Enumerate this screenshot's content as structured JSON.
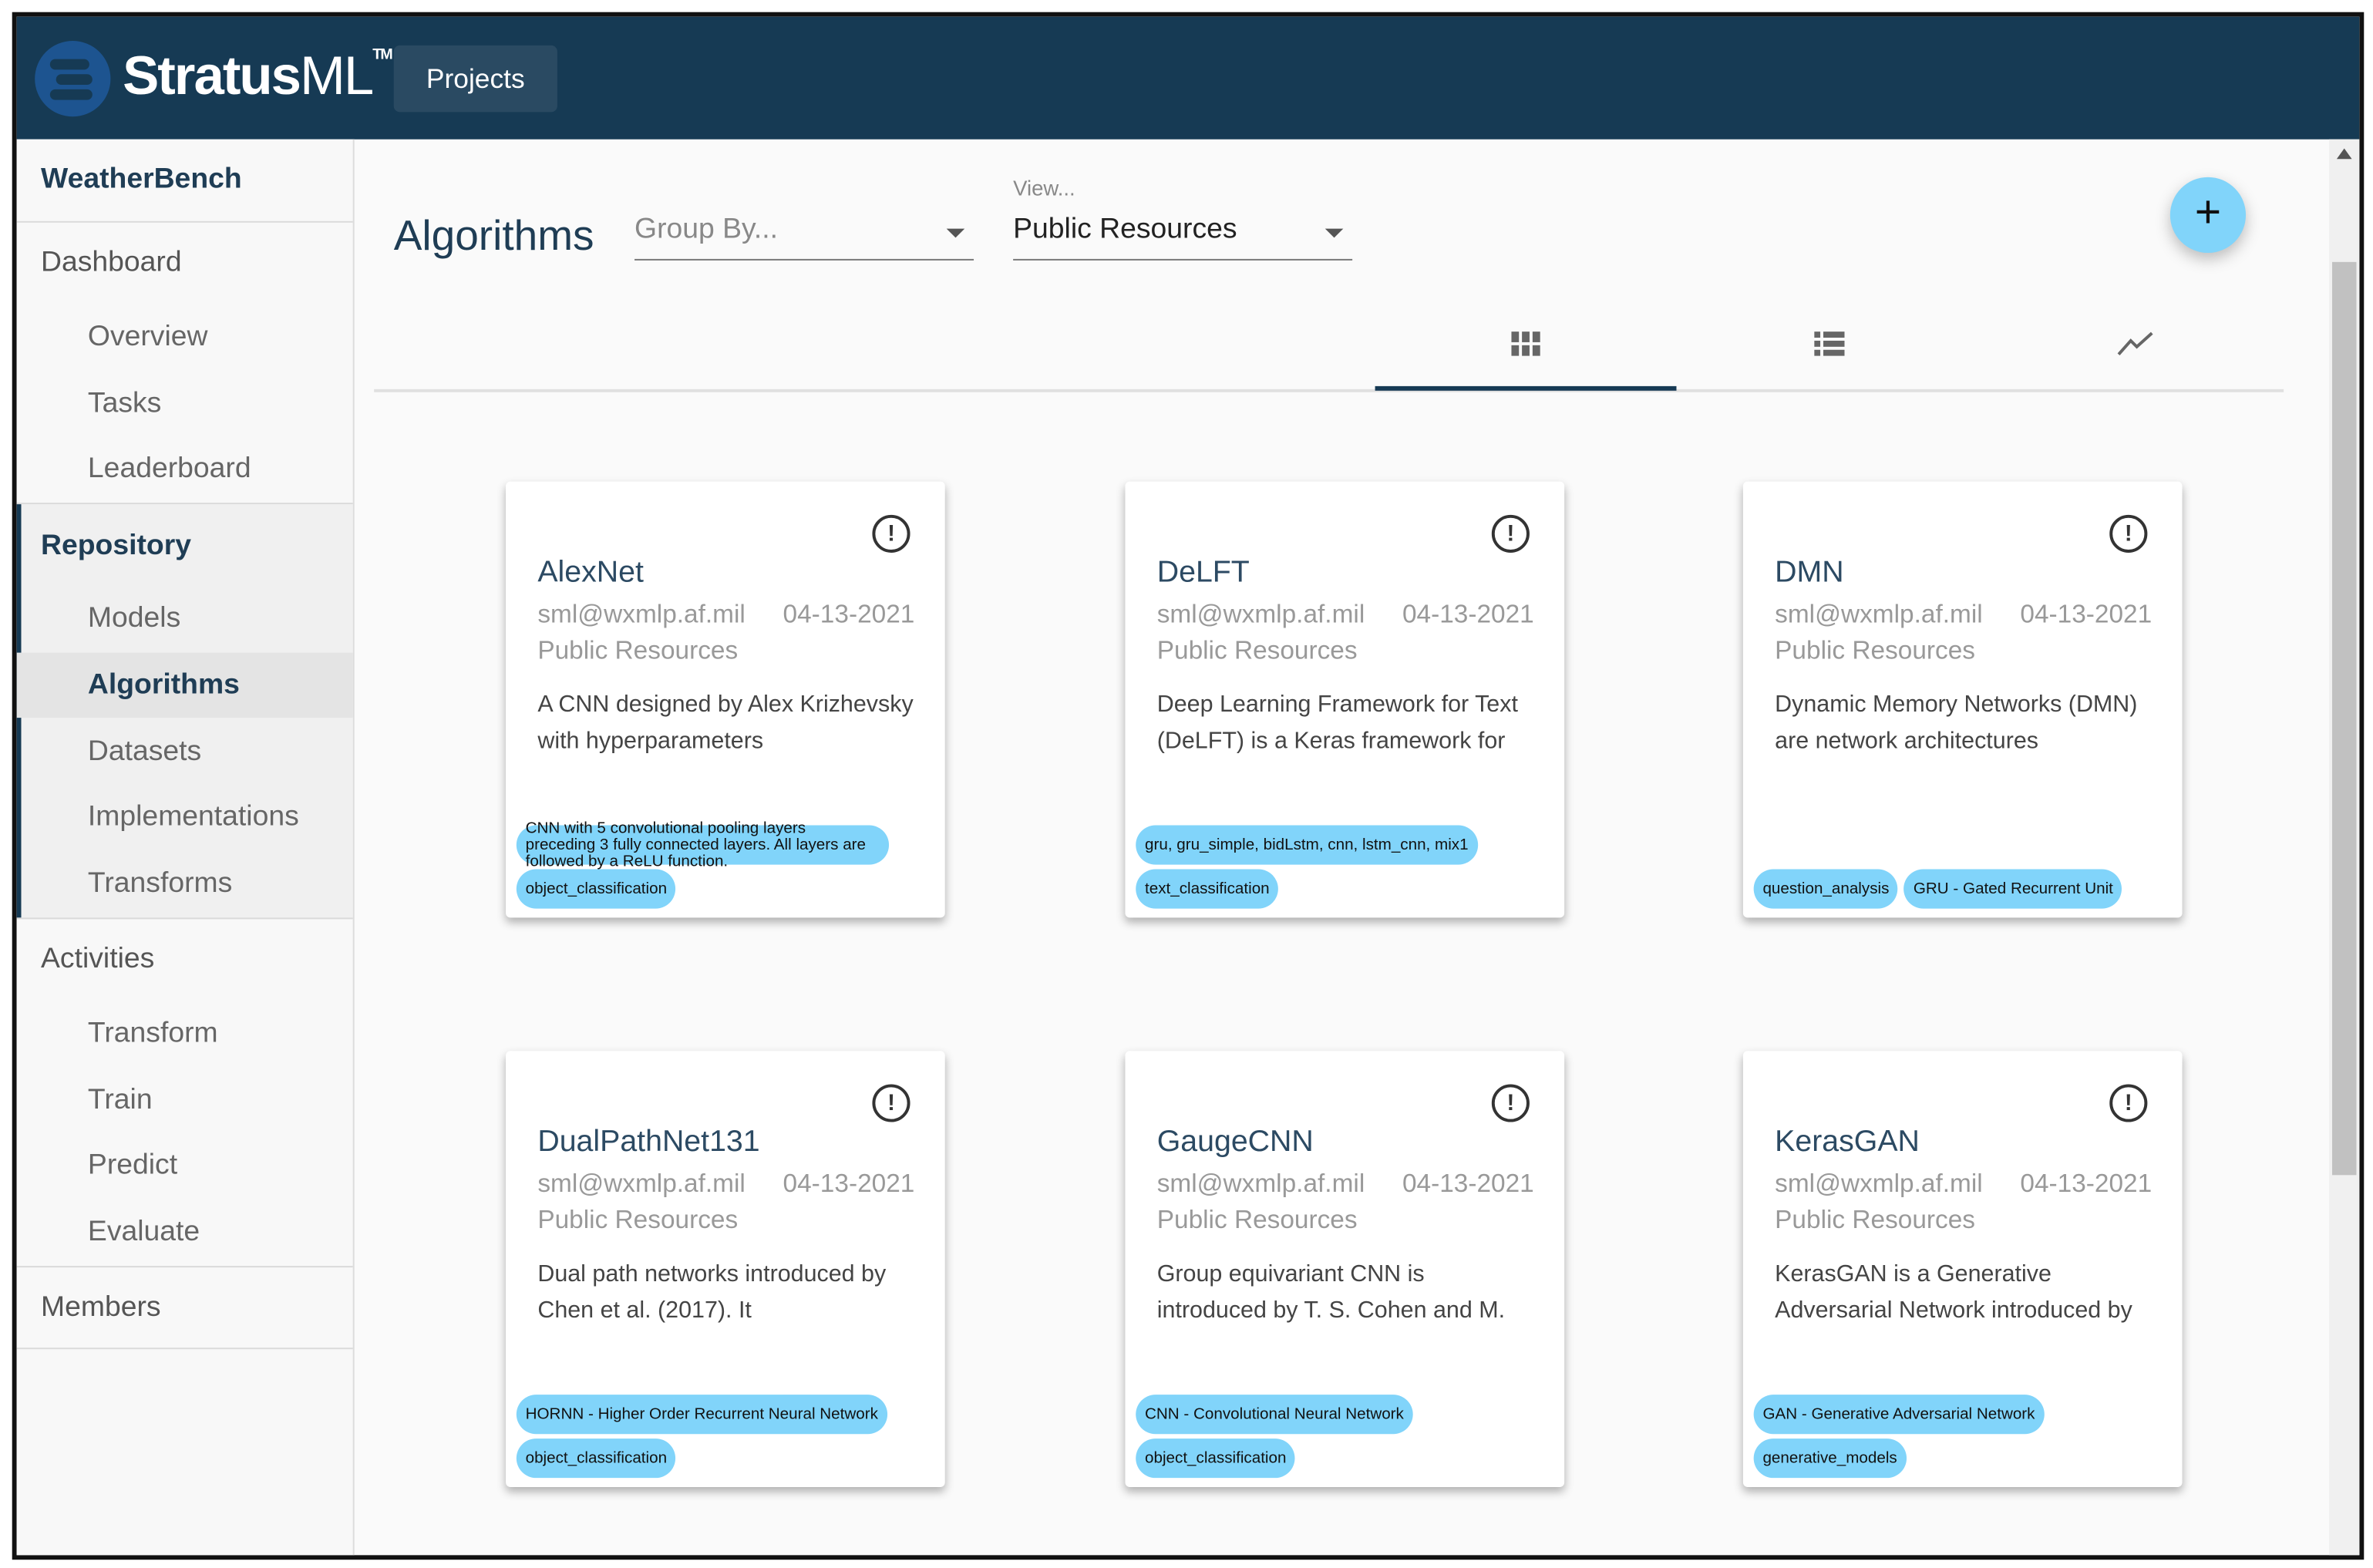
{
  "header": {
    "brand": "Stratus",
    "brand_suffix": "ML",
    "trademark": "TM",
    "projects_label": "Projects"
  },
  "sidebar": {
    "project": "WeatherBench",
    "dashboard": "Dashboard",
    "dashboard_items": [
      "Overview",
      "Tasks",
      "Leaderboard"
    ],
    "repository": "Repository",
    "repository_items": [
      "Models",
      "Algorithms",
      "Datasets",
      "Implementations",
      "Transforms"
    ],
    "activities": "Activities",
    "activities_items": [
      "Transform",
      "Train",
      "Predict",
      "Evaluate"
    ],
    "members": "Members",
    "selected": "Algorithms"
  },
  "main": {
    "title": "Algorithms",
    "group_by_placeholder": "Group By...",
    "view_label": "View...",
    "view_value": "Public Resources",
    "add_label": "+",
    "tabs": [
      "grid-view-icon",
      "list-view-icon",
      "chart-view-icon"
    ],
    "active_tab": 0
  },
  "colors": {
    "header": "#163a54",
    "chip": "#81d4fa",
    "fab": "#81d4fa",
    "title": "#2c4a63"
  },
  "cards": [
    {
      "name": "AlexNet",
      "owner": "sml@wxmlp.af.mil",
      "date": "04-13-2021",
      "view": "Public Resources",
      "desc": "A CNN designed by Alex Krizhevsky with hyperparameters",
      "tags": [
        "CNN with 5 convolutional pooling layers preceding 3 fully connected layers. All layers are followed by a ReLU function.",
        "object_classification"
      ]
    },
    {
      "name": "DeLFT",
      "owner": "sml@wxmlp.af.mil",
      "date": "04-13-2021",
      "view": "Public Resources",
      "desc": "Deep Learning Framework for Text (DeLFT) is a Keras framework for",
      "tags": [
        "gru, gru_simple, bidLstm, cnn, lstm_cnn, mix1",
        "text_classification"
      ]
    },
    {
      "name": "DMN",
      "owner": "sml@wxmlp.af.mil",
      "date": "04-13-2021",
      "view": "Public Resources",
      "desc": "Dynamic Memory Networks (DMN) are network architectures",
      "tags": [
        "question_analysis",
        "GRU - Gated Recurrent Unit"
      ]
    },
    {
      "name": "DualPathNet131",
      "owner": "sml@wxmlp.af.mil",
      "date": "04-13-2021",
      "view": "Public Resources",
      "desc": "Dual path networks introduced by Chen et al. (2017). It",
      "tags": [
        "HORNN - Higher Order Recurrent Neural Network",
        "object_classification"
      ]
    },
    {
      "name": "GaugeCNN",
      "owner": "sml@wxmlp.af.mil",
      "date": "04-13-2021",
      "view": "Public Resources",
      "desc": "Group equivariant CNN is introduced by T. S. Cohen and M.",
      "tags": [
        "CNN - Convolutional Neural Network",
        "object_classification"
      ]
    },
    {
      "name": "KerasGAN",
      "owner": "sml@wxmlp.af.mil",
      "date": "04-13-2021",
      "view": "Public Resources",
      "desc": "KerasGAN is a Generative Adversarial Network introduced by",
      "tags": [
        "GAN - Generative Adversarial Network",
        "generative_models"
      ]
    }
  ]
}
